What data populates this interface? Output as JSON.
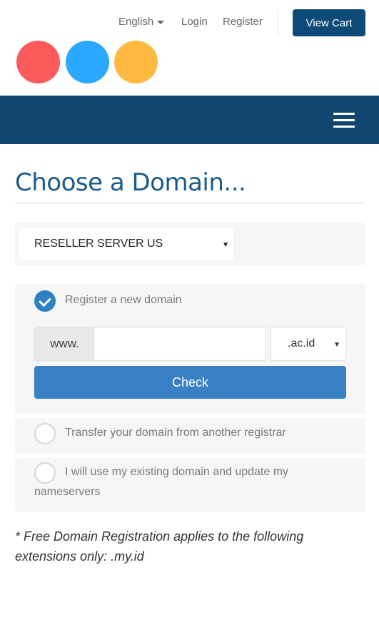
{
  "header": {
    "language": "English",
    "login": "Login",
    "register": "Register",
    "view_cart": "View Cart"
  },
  "logo": {
    "colors": [
      "#fc5a5a",
      "#2ba8ff",
      "#ffb840"
    ]
  },
  "nav": {
    "menu_icon": "hamburger-icon",
    "background": "#11476f"
  },
  "page": {
    "title": "Choose a Domain..."
  },
  "server_select": {
    "value": "RESELLER SERVER US"
  },
  "options": {
    "register": {
      "label": "Register a new domain",
      "checked": true,
      "www_prefix": "www.",
      "domain_value": "",
      "tld_value": ".ac.id",
      "check_button": "Check"
    },
    "transfer": {
      "label": "Transfer your domain from another registrar",
      "checked": false
    },
    "existing": {
      "label": "I will use my existing domain and update my nameservers",
      "checked": false
    }
  },
  "footnote": "* Free Domain Registration applies to the following extensions only: .my.id",
  "colors": {
    "primary_dark": "#0e4a78",
    "accent_blue": "#3a80c4",
    "title_blue": "#1a5b8c"
  }
}
